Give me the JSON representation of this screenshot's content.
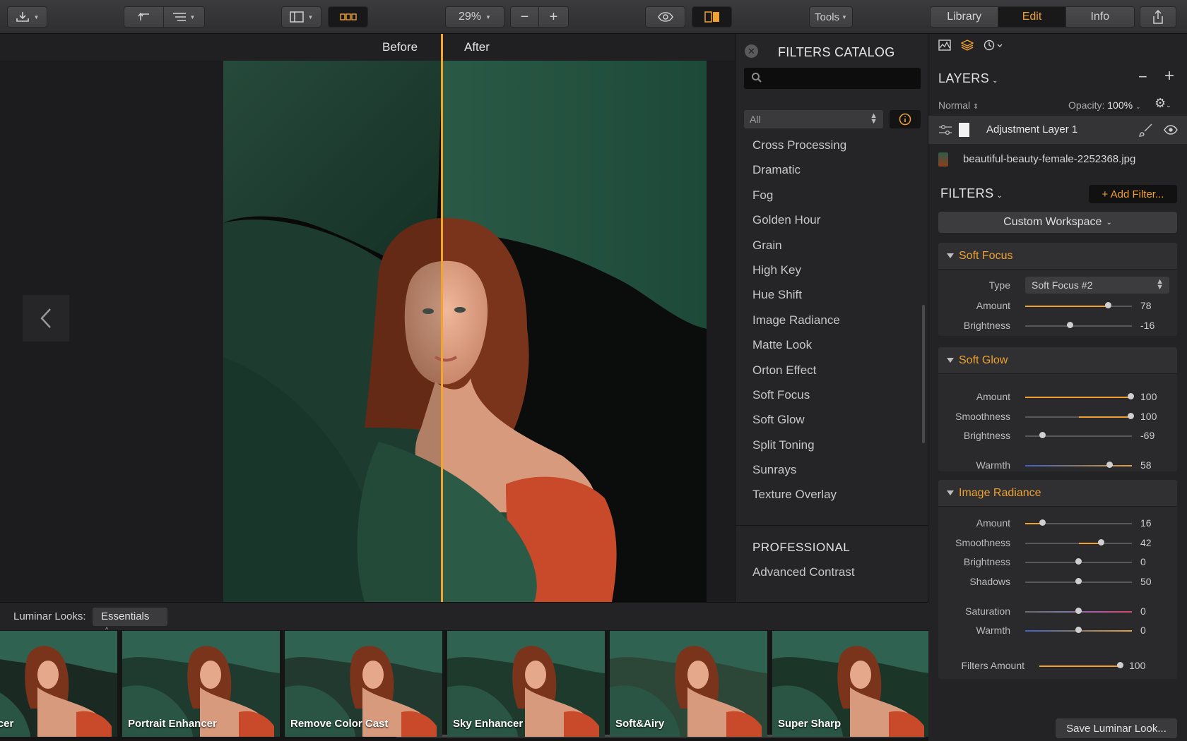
{
  "toolbar": {
    "zoom": "29%",
    "tabs": [
      "Library",
      "Edit",
      "Info"
    ],
    "active_tab": "Edit",
    "tools_label": "Tools"
  },
  "viewer": {
    "before_label": "Before",
    "after_label": "After"
  },
  "catalog": {
    "title": "FILTERS CATALOG",
    "search_placeholder": "",
    "category": "All",
    "items": [
      "Cross Processing",
      "Dramatic",
      "Fog",
      "Golden Hour",
      "Grain",
      "High Key",
      "Hue Shift",
      "Image Radiance",
      "Matte Look",
      "Orton Effect",
      "Soft Focus",
      "Soft Glow",
      "Split Toning",
      "Sunrays",
      "Texture Overlay"
    ],
    "section2": "PROFESSIONAL",
    "section2_items": [
      "Advanced Contrast"
    ]
  },
  "layers": {
    "title": "LAYERS",
    "blend": "Normal",
    "opacity_label": "Opacity:",
    "opacity_value": "100%",
    "adjustment_layer": "Adjustment Layer 1",
    "file_name": "beautiful-beauty-female-2252368.jpg"
  },
  "filters": {
    "title": "FILTERS",
    "add_button": "+ Add Filter...",
    "workspace": "Custom Workspace",
    "sections": [
      {
        "name": "Soft Focus",
        "type_label": "Type",
        "type_value": "Soft Focus #2",
        "sliders": [
          {
            "label": "Amount",
            "value": "78"
          },
          {
            "label": "Brightness",
            "value": "-16"
          }
        ]
      },
      {
        "name": "Soft Glow",
        "sliders": [
          {
            "label": "Amount",
            "value": "100"
          },
          {
            "label": "Smoothness",
            "value": "100"
          },
          {
            "label": "Brightness",
            "value": "-69"
          },
          {
            "label": "Warmth",
            "value": "58"
          }
        ]
      },
      {
        "name": "Image Radiance",
        "sliders": [
          {
            "label": "Amount",
            "value": "16"
          },
          {
            "label": "Smoothness",
            "value": "42"
          },
          {
            "label": "Brightness",
            "value": "0"
          },
          {
            "label": "Shadows",
            "value": "50"
          },
          {
            "label": "Saturation",
            "value": "0"
          },
          {
            "label": "Warmth",
            "value": "0"
          }
        ]
      }
    ],
    "filters_amount_label": "Filters Amount",
    "filters_amount_value": "100",
    "save_look": "Save Luminar Look..."
  },
  "looks": {
    "label": "Luminar Looks:",
    "collection": "Essentials",
    "thumbs": [
      "Enhancer",
      "Portrait Enhancer",
      "Remove Color Cast",
      "Sky Enhancer",
      "Soft&Airy",
      "Super Sharp"
    ]
  },
  "colors": {
    "accent": "#f0a030",
    "panel": "#232325"
  }
}
